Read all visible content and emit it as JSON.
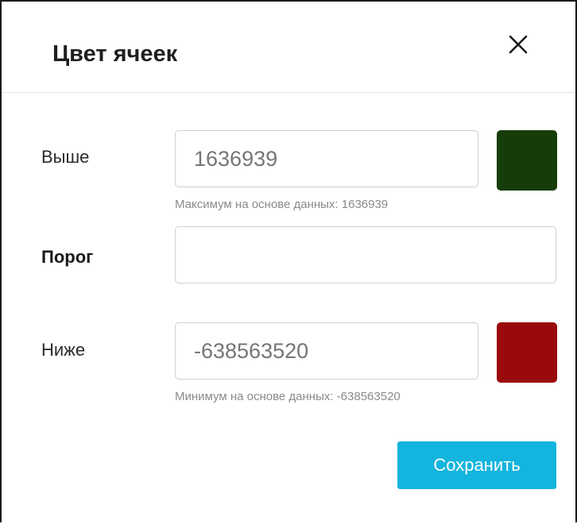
{
  "dialog": {
    "title": "Цвет ячеек",
    "close_icon": "close-icon"
  },
  "rows": {
    "above": {
      "label": "Выше",
      "value": "",
      "placeholder": "1636939",
      "hint": "Максимум на основе данных: 1636939",
      "color": "#163d09"
    },
    "threshold": {
      "label": "Порог",
      "value": "",
      "placeholder": ""
    },
    "below": {
      "label": "Ниже",
      "value": "",
      "placeholder": "-638563520",
      "hint": "Минимум на основе данных: -638563520",
      "color": "#9a0a0c"
    }
  },
  "actions": {
    "save_label": "Сохранить",
    "save_color": "#13b4dd"
  }
}
